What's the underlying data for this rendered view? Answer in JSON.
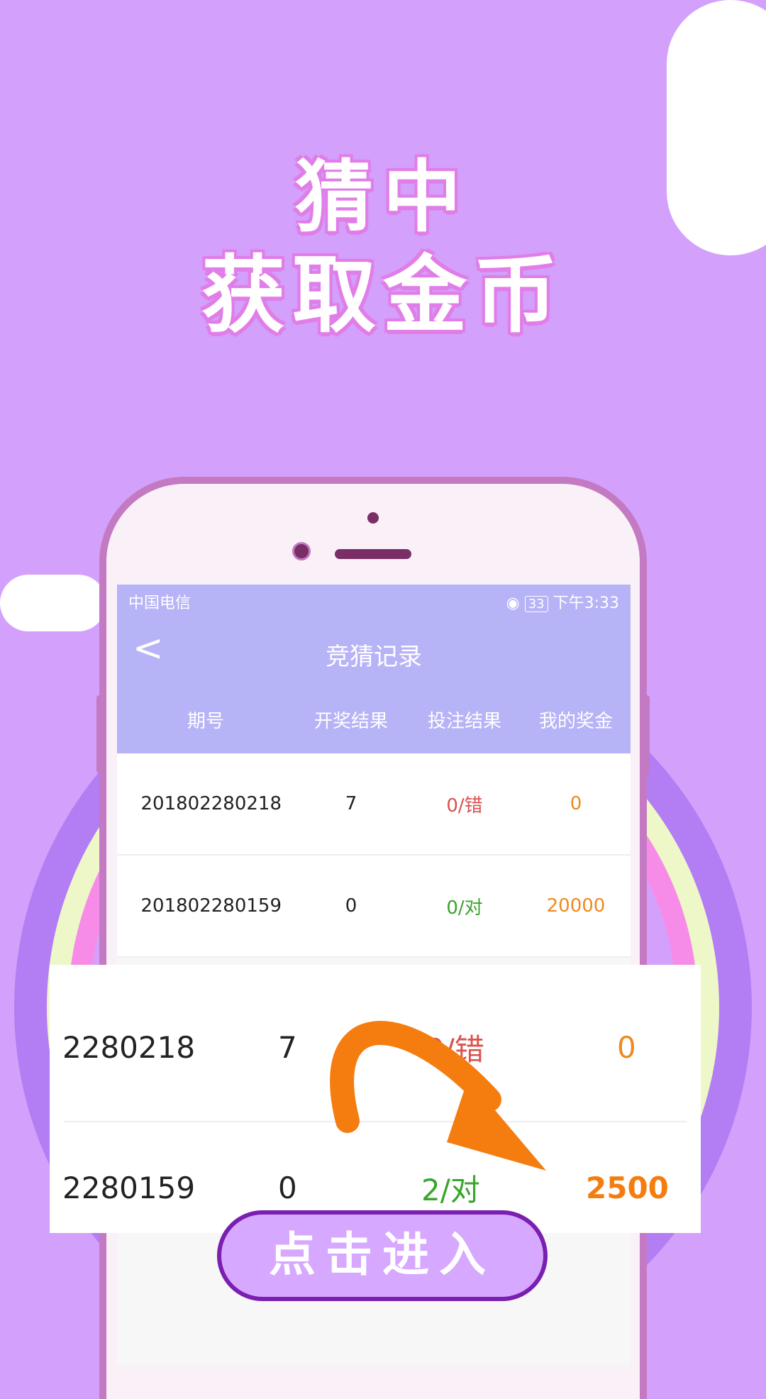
{
  "headline": {
    "line1": "猜中",
    "line2": "获取金币"
  },
  "status_bar": {
    "carrier": "中国电信",
    "battery": "33",
    "time": "下午3:33"
  },
  "nav": {
    "back_icon": "chevron-left-icon",
    "title": "竞猜记录"
  },
  "table": {
    "headers": [
      "期号",
      "开奖结果",
      "投注结果",
      "我的奖金"
    ],
    "rows": [
      {
        "period": "201802280218",
        "result": "7",
        "bet": "0/错",
        "prize": "0"
      },
      {
        "period": "201802280159",
        "result": "0",
        "bet": "0/对",
        "prize": "20000"
      }
    ]
  },
  "zoom": {
    "rows": [
      {
        "period": "2280218",
        "result": "7",
        "bet": "0/错",
        "prize": "0"
      },
      {
        "period": "2280159",
        "result": "0",
        "bet": "2/对",
        "prize": "2500"
      }
    ]
  },
  "enter_button": {
    "label": "点击进入"
  },
  "colors": {
    "background": "#d3a1fb",
    "header_bar": "#b7b3f7",
    "wrong": "#d9534f",
    "right": "#3aa52c",
    "prize": "#ef8a1f",
    "arrow": "#f57d10"
  }
}
